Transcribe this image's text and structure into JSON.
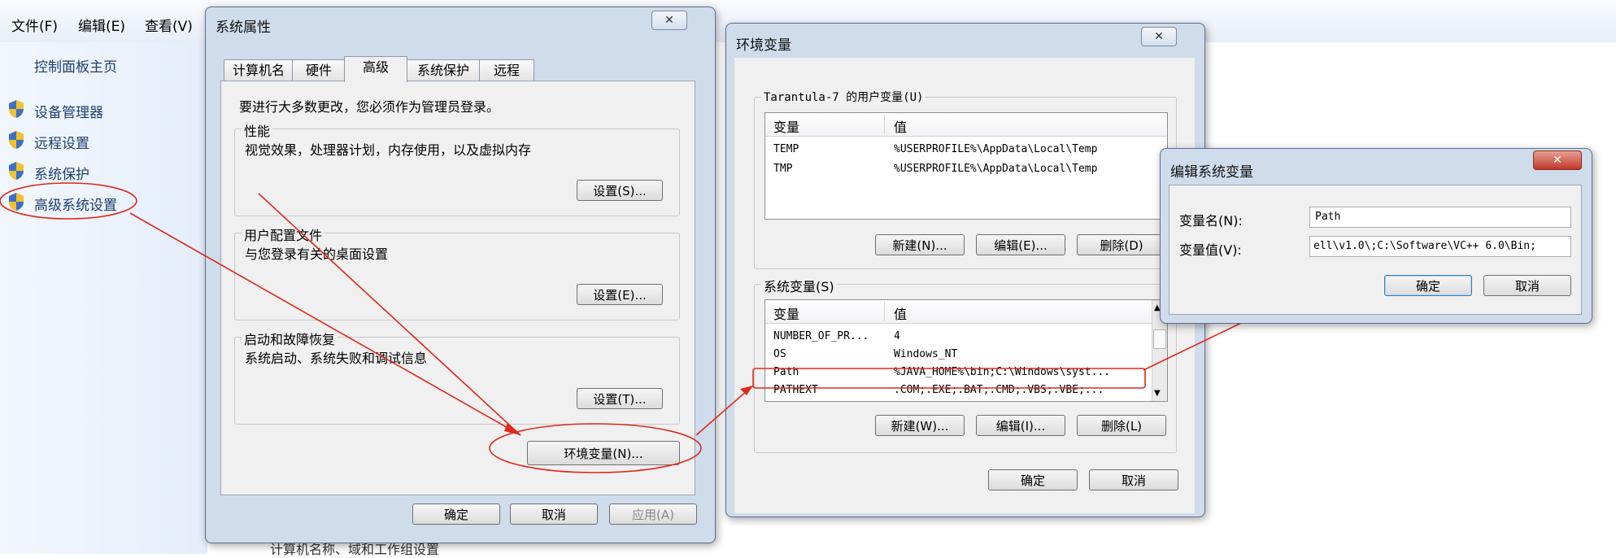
{
  "control_panel": {
    "menu": [
      "文件(F)",
      "编辑(E)",
      "查看(V)"
    ],
    "home_link": "控制面板主页",
    "links": [
      "设备管理器",
      "远程设置",
      "系统保护",
      "高级系统设置"
    ],
    "bottom_text": "计算机名称、域和工作组设置"
  },
  "sys_props": {
    "title": "系统属性",
    "tabs": [
      "计算机名",
      "硬件",
      "高级",
      "系统保护",
      "远程"
    ],
    "active_tab": "高级",
    "admin_note": "要进行大多数更改，您必须作为管理员登录。",
    "performance": {
      "label": "性能",
      "desc": "视觉效果，处理器计划，内存使用，以及虚拟内存",
      "button": "设置(S)..."
    },
    "profiles": {
      "label": "用户配置文件",
      "desc": "与您登录有关的桌面设置",
      "button": "设置(E)..."
    },
    "startup": {
      "label": "启动和故障恢复",
      "desc": "系统启动、系统失败和调试信息",
      "button": "设置(T)..."
    },
    "env_button": "环境变量(N)...",
    "ok": "确定",
    "cancel": "取消",
    "apply": "应用(A)"
  },
  "env_vars": {
    "title": "环境变量",
    "user_group": "Tarantula-7 的用户变量(U)",
    "col_var": "变量",
    "col_val": "值",
    "user_rows": [
      {
        "name": "TEMP",
        "value": "%USERPROFILE%\\AppData\\Local\\Temp"
      },
      {
        "name": "TMP",
        "value": "%USERPROFILE%\\AppData\\Local\\Temp"
      }
    ],
    "user_buttons": [
      "新建(N)...",
      "编辑(E)...",
      "删除(D)"
    ],
    "sys_group": "系统变量(S)",
    "sys_rows": [
      {
        "name": "NUMBER_OF_PR...",
        "value": "4"
      },
      {
        "name": "OS",
        "value": "Windows_NT"
      },
      {
        "name": "Path",
        "value": "%JAVA_HOME%\\bin;C:\\Windows\\syst..."
      },
      {
        "name": "PATHEXT",
        "value": ".COM;.EXE;.BAT;.CMD;.VBS;.VBE;..."
      }
    ],
    "sys_buttons": [
      "新建(W)...",
      "编辑(I)...",
      "删除(L)"
    ],
    "ok": "确定",
    "cancel": "取消"
  },
  "edit_var": {
    "title": "编辑系统变量",
    "name_label": "变量名(N):",
    "value_label": "变量值(V):",
    "name_value": "Path",
    "value_value": "ell\\v1.0\\;C:\\Software\\VC++ 6.0\\Bin;",
    "ok": "确定",
    "cancel": "取消"
  },
  "colors": {
    "annotation": "#e0281e",
    "title_bar": "#cfdcec"
  }
}
